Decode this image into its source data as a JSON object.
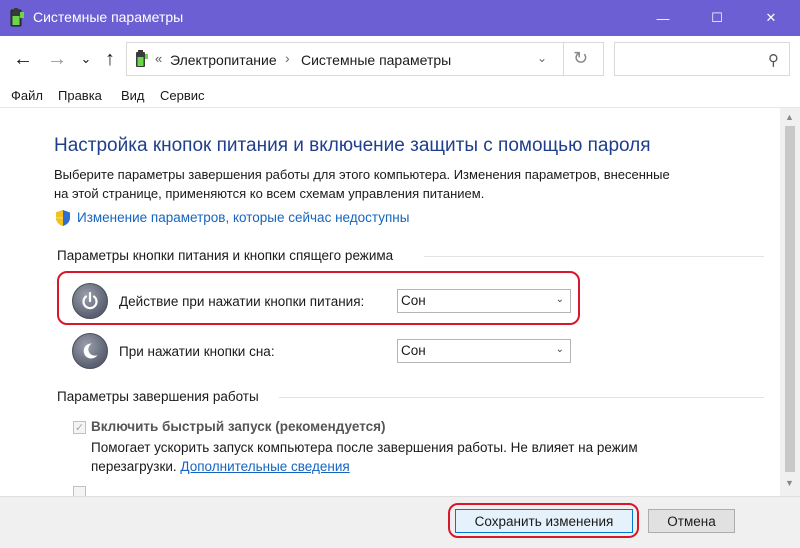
{
  "window": {
    "title": "Системные параметры",
    "minimize_glyph": "—",
    "maximize_glyph": "☐",
    "close_glyph": "✕"
  },
  "nav": {
    "back_glyph": "←",
    "forward_glyph": "→",
    "recent_glyph": "⌄",
    "up_glyph": "↑",
    "breadcrumb_sep": "«",
    "breadcrumb": [
      "Электропитание",
      "Системные параметры"
    ],
    "crumb_arrow": "›",
    "dropdown_glyph": "⌄",
    "refresh_glyph": "↻",
    "search_placeholder": "",
    "search_glyph": "⚲"
  },
  "menu": [
    "Файл",
    "Правка",
    "Вид",
    "Сервис"
  ],
  "page": {
    "heading": "Настройка кнопок питания и включение защиты с помощью пароля",
    "description_line1": "Выберите параметры завершения работы для этого компьютера. Изменения параметров, внесенные",
    "description_line2": "на этой странице, применяются ко всем схемам управления питанием.",
    "change_link": "Изменение параметров, которые сейчас недоступны",
    "power_group_title": "Параметры кнопки питания и кнопки спящего режима",
    "power_button_label": "Действие при нажатии кнопки питания:",
    "power_button_value": "Сон",
    "sleep_button_label": "При нажатии кнопки сна:",
    "sleep_button_value": "Сон",
    "shutdown_group_title": "Параметры завершения работы",
    "fast_startup_label": "Включить быстрый запуск (рекомендуется)",
    "fast_startup_desc_line1": "Помогает ускорить запуск компьютера после завершения работы. Не влияет на режим",
    "fast_startup_desc_line2_prefix": "перезагрузки.",
    "fast_startup_more_link": "Дополнительные сведения",
    "check_glyph": "✓",
    "select_arrow": "⌄"
  },
  "footer": {
    "save_label": "Сохранить изменения",
    "cancel_label": "Отмена"
  },
  "colors": {
    "titlebar": "#6b5fd3",
    "heading": "#1f3f8c",
    "link": "#1565c0",
    "highlight": "#d8182a"
  },
  "icons": [
    "app-battery-icon",
    "folder-battery-icon",
    "shield-icon",
    "power-button-icon",
    "sleep-button-icon"
  ]
}
